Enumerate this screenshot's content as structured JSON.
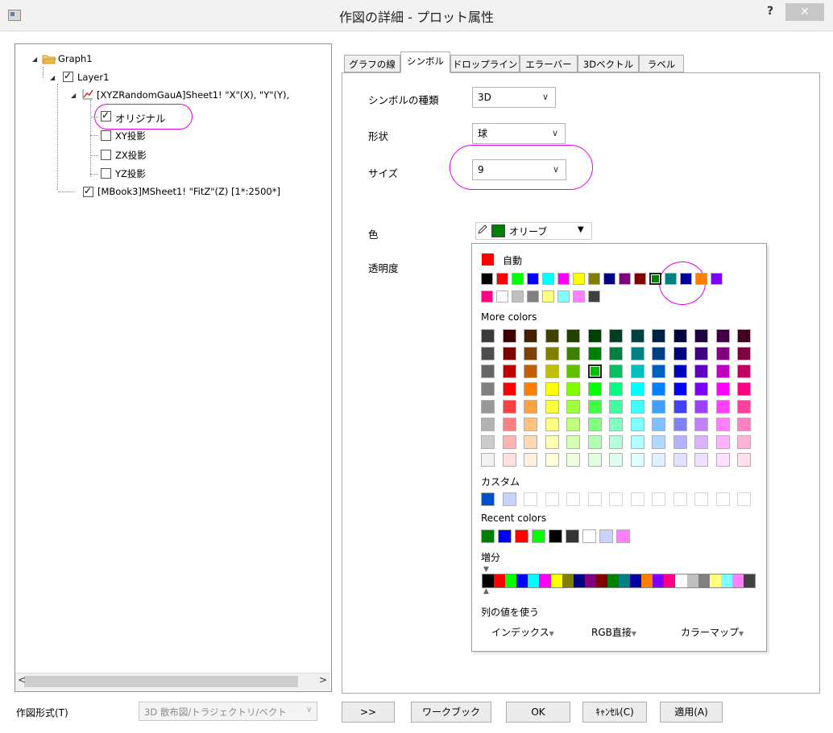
{
  "window": {
    "title": "作図の詳細 - プロット属性",
    "help": "?",
    "close": "✕"
  },
  "tree": {
    "graph": "Graph1",
    "layer": "Layer1",
    "plot": "[XYZRandomGauA]Sheet1! \"X\"(X), \"Y\"(Y),",
    "original": "オリジナル",
    "xy": "XY投影",
    "zx": "ZX投影",
    "yz": "YZ投影",
    "fit": "[MBook3]MSheet1! \"FitZ\"(Z) [1*:2500*]"
  },
  "bottom": {
    "plot_type_label": "作図形式(T)",
    "plot_type_value": "3D 散布図/トラジェクトリ/ベクト",
    "expand": ">>",
    "workbook": "ワークブック",
    "ok": "OK",
    "cancel": "ｷｬﾝｾﾙ(C)",
    "apply": "適用(A)"
  },
  "tabs": [
    "グラフの線",
    "シンボル",
    "ドロップライン",
    "エラーバー",
    "3Dベクトル",
    "ラベル"
  ],
  "symbol": {
    "type_label": "シンボルの種類",
    "type_value": "3D",
    "shape_label": "形状",
    "shape_value": "球",
    "size_label": "サイズ",
    "size_value": "9",
    "color_label": "色",
    "color_value": "オリーブ",
    "transparency_label": "透明度"
  },
  "palette": {
    "auto_label": "自動",
    "more_colors": "More colors",
    "custom": "カスタム",
    "recent": "Recent colors",
    "increment": "増分",
    "use_col": "列の値を使う",
    "index": "インデックス",
    "rgb": "RGB直接",
    "colormap": "カラーマップ",
    "auto_color": "#ff0000",
    "selected_color": "#008000",
    "basic_row1": [
      "#000000",
      "#ff0000",
      "#00ff00",
      "#0000ff",
      "#00ffff",
      "#ff00ff",
      "#ffff00",
      "#808000",
      "#000080",
      "#800080",
      "#800000",
      "#008000",
      "#008080",
      "#0000a0",
      "#ff8000",
      "#8000ff"
    ],
    "basic_row2": [
      "#ff0080",
      "#ffffff",
      "#c0c0c0",
      "#808080",
      "#ffff80",
      "#80ffff",
      "#ff80ff",
      "#404040"
    ],
    "more_grid": [
      [
        "#3a3a3a",
        "#400000",
        "#402000",
        "#404000",
        "#204000",
        "#004000",
        "#004020",
        "#004040",
        "#002040",
        "#000040",
        "#200040",
        "#400040",
        "#400020"
      ],
      [
        "#4d4d4d",
        "#800000",
        "#804000",
        "#808000",
        "#408000",
        "#008000",
        "#008040",
        "#008080",
        "#004080",
        "#000080",
        "#400080",
        "#800080",
        "#800040"
      ],
      [
        "#666666",
        "#c00000",
        "#c06000",
        "#c0c000",
        "#60c000",
        "#00c000",
        "#00c060",
        "#00c0c0",
        "#0060c0",
        "#0000c0",
        "#6000c0",
        "#c000c0",
        "#c00060"
      ],
      [
        "#808080",
        "#ff0000",
        "#ff8000",
        "#ffff00",
        "#80ff00",
        "#00ff00",
        "#00ff80",
        "#00ffff",
        "#0080ff",
        "#0000ff",
        "#8000ff",
        "#ff00ff",
        "#ff0080"
      ],
      [
        "#999999",
        "#ff4040",
        "#ffa040",
        "#ffff40",
        "#a0ff40",
        "#40ff40",
        "#40ffa0",
        "#40ffff",
        "#40a0ff",
        "#4040ff",
        "#a040ff",
        "#ff40ff",
        "#ff40a0"
      ],
      [
        "#b3b3b3",
        "#ff8080",
        "#ffc080",
        "#ffff80",
        "#c0ff80",
        "#80ff80",
        "#80ffc0",
        "#80ffff",
        "#80c0ff",
        "#8080ff",
        "#c080ff",
        "#ff80ff",
        "#ff80c0"
      ],
      [
        "#cccccc",
        "#ffb3b3",
        "#ffd9b3",
        "#ffffb3",
        "#d9ffb3",
        "#b3ffb3",
        "#b3ffd9",
        "#b3ffff",
        "#b3d9ff",
        "#b3b3ff",
        "#d9b3ff",
        "#ffb3ff",
        "#ffb3d9"
      ],
      [
        "#f2f2f2",
        "#ffe0e0",
        "#fff0e0",
        "#ffffe0",
        "#f0ffe0",
        "#e0ffe0",
        "#e0fff0",
        "#e0ffff",
        "#e0f0ff",
        "#e0e0ff",
        "#f0e0ff",
        "#ffe0ff",
        "#ffe0f0"
      ]
    ],
    "custom_colors": [
      "#0050c8",
      "#c8d2ff"
    ],
    "recent_colors": [
      "#008000",
      "#0000ff",
      "#ff0000",
      "#00ff00",
      "#000000",
      "#333333",
      "#ffffff",
      "#c8d2ff",
      "#ff80ff"
    ],
    "increment_colors": [
      "#000000",
      "#ff0000",
      "#00ff00",
      "#0000ff",
      "#00ffff",
      "#ff00ff",
      "#ffff00",
      "#808000",
      "#000080",
      "#800080",
      "#800000",
      "#008000",
      "#008080",
      "#0000a0",
      "#ff8000",
      "#8000ff",
      "#ff0080",
      "#ffffff",
      "#c0c0c0",
      "#808080",
      "#ffff80",
      "#80ffff",
      "#ff80ff",
      "#404040"
    ]
  },
  "accents": {
    "highlight": "#e600e6",
    "folder": "#e8b84a",
    "plot_icon": "#d42020"
  },
  "icons": [
    "folder-icon",
    "line-plot-icon",
    "pencil-icon",
    "dropdown-arrow-icon"
  ]
}
